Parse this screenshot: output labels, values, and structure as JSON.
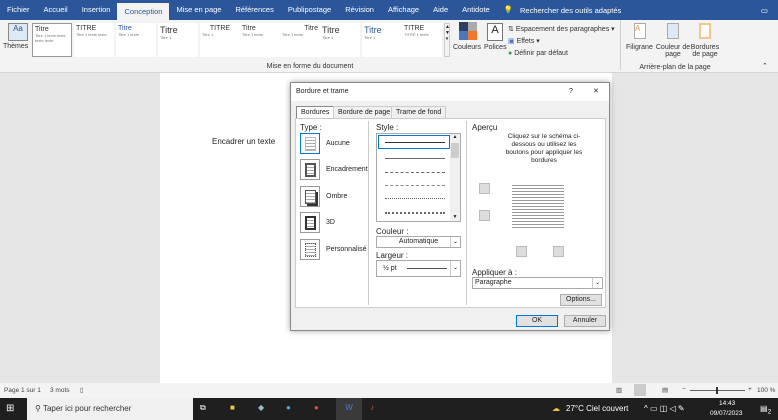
{
  "ribbon_tabs": [
    "Fichier",
    "Accueil",
    "Insertion",
    "Conception",
    "Mise en page",
    "Références",
    "Publipostage",
    "Révision",
    "Affichage",
    "Aide",
    "Antidote"
  ],
  "active_tab": "Conception",
  "search_tools": "Rechercher des outils adaptés",
  "ribbon": {
    "themes": "Thèmes",
    "gallery_titles": [
      "Titre",
      "TITRE",
      "Titre",
      "Titre",
      "TITRE",
      "Titre",
      "Titre",
      "Titre",
      "Titre",
      "TITRE"
    ],
    "couleurs": "Couleurs",
    "polices": "Polices",
    "espacement": "Espacement des paragraphes",
    "effets": "Effets",
    "definir": "Définir par défaut",
    "group_doc": "Mise en forme du document",
    "filigrane": "Filigrane",
    "couleur_page": "Couleur de page",
    "bordures_page": "Bordures de page",
    "group_bg": "Arrière-plan de la page"
  },
  "document": {
    "text": "Encadrer un texte"
  },
  "dialog": {
    "title": "Bordure et trame",
    "help": "?",
    "close": "✕",
    "tabs": [
      "Bordures",
      "Bordure de page",
      "Trame de fond"
    ],
    "type_label": "Type :",
    "types": [
      "Aucune",
      "Encadrement",
      "Ombre",
      "3D",
      "Personnalisé"
    ],
    "style_label": "Style :",
    "couleur_label": "Couleur :",
    "couleur_value": "Automatique",
    "largeur_label": "Largeur :",
    "largeur_value": "½ pt",
    "apercu_label": "Aperçu",
    "apercu_hint": "Cliquez sur le schéma ci-dessous ou utilisez les boutons pour appliquer les bordures",
    "appliquer_label": "Appliquer à :",
    "appliquer_value": "Paragraphe",
    "options": "Options...",
    "ok": "OK",
    "cancel": "Annuler"
  },
  "status": {
    "page": "Page 1 sur 1",
    "words": "3 mots",
    "zoom": "100 %"
  },
  "taskbar": {
    "search_placeholder": "Taper ici pour rechercher",
    "weather": "27°C  Ciel couvert",
    "time": "14:43",
    "date": "09/07/2023",
    "notifications": "2"
  },
  "colors": {
    "accent": "#2b579a",
    "taskbar": "#1f1f1f",
    "ok_border": "#0078d7"
  }
}
